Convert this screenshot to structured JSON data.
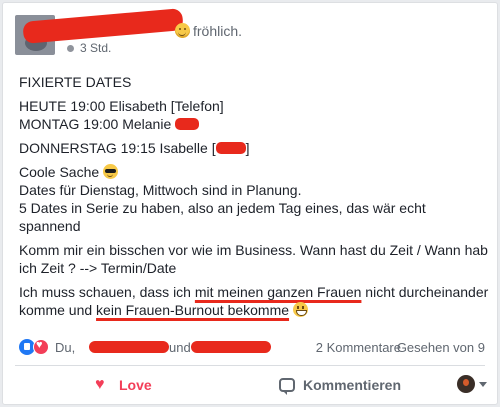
{
  "header": {
    "feeling": "fröhlich.",
    "time": "3 Std."
  },
  "post": {
    "title": "FIXIERTE DATES",
    "heute": "HEUTE 19:00 Elisabeth [Telefon]",
    "montag": "MONTAG 19:00 Melanie",
    "donnerstag": "DONNERSTAG 19:15 Isabelle [",
    "bracket_close": "]",
    "coole": "Coole Sache",
    "line_dates": "Dates für Dienstag, Mittwoch sind in Planung.",
    "line_serie": "5 Dates in Serie zu haben, also an jedem Tag eines, das wär echt spannend",
    "line_business": "Komm mir ein bisschen vor wie im Business. Wann hast du Zeit / Wann hab ich Zeit ? --> Termin/Date",
    "line_muss_a": "Ich muss schauen, dass ich ",
    "line_muss_b": "mit meinen ganzen Frauen",
    "line_muss_c": " nicht durcheinander komme und ",
    "line_muss_d": "kein Frauen-Burnout bekomme"
  },
  "reactions": {
    "names_start": "Du,",
    "und": "und",
    "comments": "2 Kommentare",
    "seen": "Gesehen von 9"
  },
  "actions": {
    "love": "Love",
    "comment": "Kommentieren"
  },
  "colors": {
    "love": "#f33e58",
    "like": "#2078f4",
    "redaction": "#e8291c"
  }
}
